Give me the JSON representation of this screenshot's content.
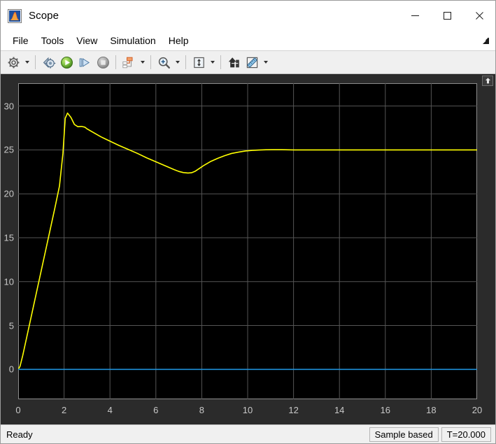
{
  "window": {
    "title": "Scope",
    "app_icon": "simulink-scope-icon",
    "controls": {
      "minimize": "minimize-button",
      "maximize": "maximize-button",
      "close": "close-button"
    }
  },
  "menubar": {
    "items": [
      {
        "label": "File"
      },
      {
        "label": "Tools"
      },
      {
        "label": "View"
      },
      {
        "label": "Simulation"
      },
      {
        "label": "Help"
      }
    ],
    "undock_icon": "undock-arrow-icon"
  },
  "toolbar": {
    "groups": [
      {
        "buttons": [
          {
            "name": "configuration-properties-button",
            "icon": "gear-icon",
            "has_dropdown": true,
            "enabled": true
          }
        ]
      },
      {
        "buttons": [
          {
            "name": "run-back-to-start-button",
            "icon": "rewind-icon",
            "has_dropdown": false,
            "enabled": true
          },
          {
            "name": "run-button",
            "icon": "play-icon",
            "has_dropdown": false,
            "enabled": true
          },
          {
            "name": "step-forward-button",
            "icon": "step-forward-icon",
            "has_dropdown": false,
            "enabled": true
          },
          {
            "name": "stop-button",
            "icon": "stop-icon",
            "has_dropdown": false,
            "enabled": false
          }
        ]
      },
      {
        "buttons": [
          {
            "name": "signal-selection-button",
            "icon": "signal-selector-icon",
            "has_dropdown": true,
            "enabled": true
          }
        ]
      },
      {
        "buttons": [
          {
            "name": "zoom-in-button",
            "icon": "magnifier-plus-icon",
            "has_dropdown": true,
            "enabled": true
          }
        ]
      },
      {
        "buttons": [
          {
            "name": "autoscale-button",
            "icon": "autoscale-icon",
            "has_dropdown": true,
            "enabled": true
          }
        ]
      },
      {
        "buttons": [
          {
            "name": "cursor-measurements-button",
            "icon": "cursor-icon",
            "has_dropdown": false,
            "enabled": true
          },
          {
            "name": "measurements-button",
            "icon": "ruler-icon",
            "has_dropdown": true,
            "enabled": true
          }
        ]
      }
    ]
  },
  "scope": {
    "scroll_up_icon": "scroll-up-icon"
  },
  "statusbar": {
    "status": "Ready",
    "cells": [
      {
        "label": "Sample based"
      },
      {
        "label": "T=20.000"
      }
    ]
  },
  "chart_data": {
    "type": "line",
    "title": "",
    "xlabel": "",
    "ylabel": "",
    "xlim": [
      0,
      20
    ],
    "ylim": [
      -3.4,
      32.6
    ],
    "xticks": [
      0,
      2,
      4,
      6,
      8,
      10,
      12,
      14,
      16,
      18,
      20
    ],
    "yticks": [
      0,
      5,
      10,
      15,
      20,
      25,
      30
    ],
    "grid": true,
    "background": "#000000",
    "grid_color": "#555555",
    "tick_color": "#c8c8c8",
    "legend": "none",
    "series": [
      {
        "name": "signal-1",
        "color": "#FFFF00",
        "x": [
          0,
          0.08,
          0.2,
          0.4,
          0.6,
          0.8,
          1.0,
          1.2,
          1.4,
          1.6,
          1.8,
          1.95,
          2.05,
          2.15,
          2.3,
          2.45,
          2.6,
          2.75,
          2.9,
          3.0,
          3.2,
          3.4,
          3.6,
          3.8,
          4.0,
          4.4,
          4.8,
          5.2,
          5.6,
          6.0,
          6.4,
          6.8,
          7.0,
          7.2,
          7.4,
          7.55,
          7.7,
          7.9,
          8.1,
          8.4,
          8.7,
          9.0,
          9.3,
          9.6,
          9.9,
          10.2,
          10.5,
          10.8,
          11.1,
          11.5,
          12.0,
          13.0,
          14.0,
          15.0,
          16.0,
          17.0,
          18.0,
          19.0,
          20.0
        ],
        "y": [
          0,
          0.35,
          1.6,
          4.0,
          6.4,
          8.8,
          11.2,
          13.6,
          16.0,
          18.4,
          20.9,
          24.6,
          28.6,
          29.2,
          28.7,
          27.9,
          27.65,
          27.68,
          27.6,
          27.4,
          27.1,
          26.8,
          26.5,
          26.25,
          26.0,
          25.5,
          25.05,
          24.6,
          24.1,
          23.65,
          23.2,
          22.75,
          22.55,
          22.42,
          22.37,
          22.4,
          22.55,
          22.9,
          23.25,
          23.7,
          24.05,
          24.35,
          24.6,
          24.75,
          24.88,
          24.95,
          24.99,
          25.02,
          25.03,
          25.03,
          25.0,
          25.0,
          25.0,
          25.0,
          25.0,
          25.0,
          25.0,
          25.0,
          25.0
        ]
      },
      {
        "name": "reference-zero-line",
        "color": "#1E90D8",
        "x": [
          0,
          20
        ],
        "y": [
          0,
          0
        ]
      }
    ]
  }
}
